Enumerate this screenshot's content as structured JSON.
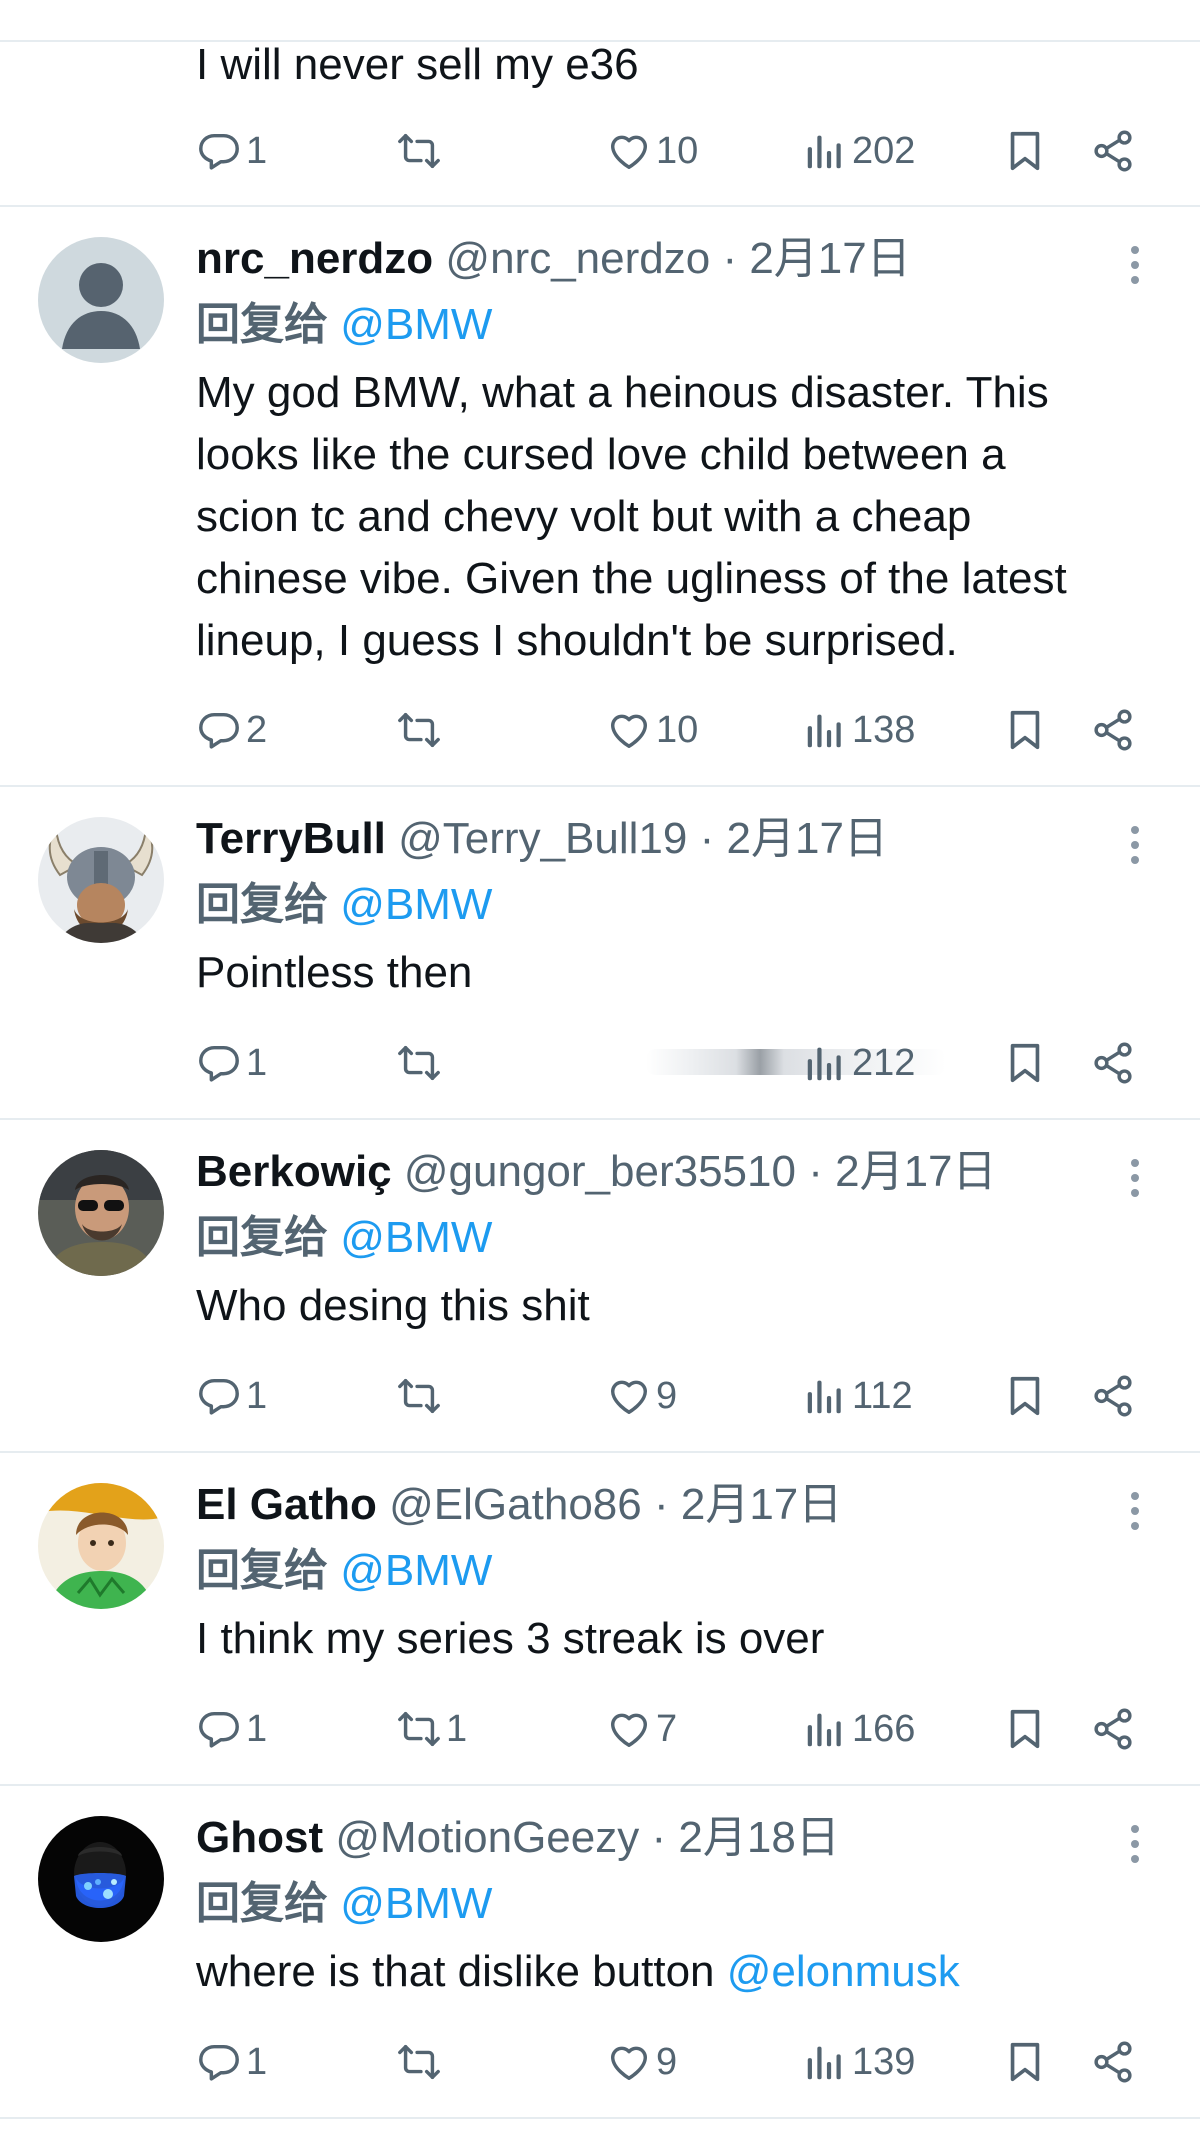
{
  "first_tweet": {
    "text": "I will never sell my e36",
    "replies": "1",
    "retweets": "",
    "likes": "10",
    "views": "202"
  },
  "reply_prefix": "回复给",
  "tweets": [
    {
      "name": "nrc_nerdzo",
      "handle": "@nrc_nerdzo",
      "date": "2月17日",
      "reply_to": "@BMW",
      "text_lines": [
        "My god BMW, what a heinous disaster. This",
        "looks like the cursed love child between a",
        "scion tc and chevy volt but with a cheap",
        "chinese vibe. Given the ugliness of the latest",
        "lineup, I guess I shouldn't be surprised."
      ],
      "replies": "2",
      "retweets": "",
      "likes": "10",
      "views": "138",
      "avatar": "default-avatar"
    },
    {
      "name": "TerryBull",
      "handle": "@Terry_Bull19",
      "date": "2月17日",
      "reply_to": "@BMW",
      "text_lines": [
        "Pointless then"
      ],
      "replies": "1",
      "retweets": "",
      "likes": "",
      "views": "212",
      "avatar": "viking-helmet-avatar"
    },
    {
      "name": "Berkowiç",
      "handle": "@gungor_ber35510",
      "date": "2月17日",
      "reply_to": "@BMW",
      "text_lines": [
        "Who desing this shit"
      ],
      "replies": "1",
      "retweets": "",
      "likes": "9",
      "views": "112",
      "avatar": "sunglasses-avatar"
    },
    {
      "name": "El Gatho",
      "handle": "@ElGatho86",
      "date": "2月17日",
      "reply_to": "@BMW",
      "text_lines": [
        "I think my series 3 streak is over"
      ],
      "replies": "1",
      "retweets": "1",
      "likes": "7",
      "views": "166",
      "avatar": "anime-avatar"
    },
    {
      "name": "Ghost",
      "handle": "@MotionGeezy",
      "date": "2月18日",
      "reply_to": "@BMW",
      "text_lines": [
        "where is that dislike button "
      ],
      "text_mention": "@elonmusk",
      "replies": "1",
      "retweets": "",
      "likes": "9",
      "views": "139",
      "avatar": "blue-mask-avatar"
    }
  ],
  "colors": {
    "text": "#0f1419",
    "secondary": "#536471",
    "link": "#1d9bf0",
    "divider": "#e6ecf0"
  }
}
